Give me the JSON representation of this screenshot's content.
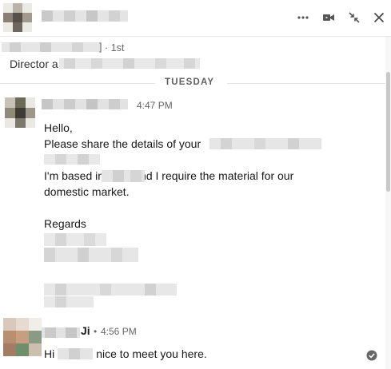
{
  "header": {
    "icons": {
      "more": "more-horizontal-icon",
      "video": "video-camera-icon",
      "minimize": "collapse-icon",
      "close": "close-icon"
    }
  },
  "intro": {
    "degree": "· 1st",
    "bracket": "]",
    "title_prefix": "Director a"
  },
  "day_divider": "TUESDAY",
  "messages": [
    {
      "time": "4:47 PM",
      "lines": {
        "greeting": "Hello,",
        "share": "Please share the details of your",
        "based_a": "I'm based in",
        "based_b": "nd I require the material for our",
        "domestic": "domestic market.",
        "regards": "Regards"
      }
    },
    {
      "name_suffix": "Ji",
      "separator": "•",
      "time": "4:56 PM",
      "text_a": "Hi",
      "text_b": "nice to meet you here."
    }
  ],
  "colors": {
    "divider": "#e3e3e3",
    "text_primary": "#191919",
    "text_secondary": "#666666",
    "blur": "#dedede"
  }
}
